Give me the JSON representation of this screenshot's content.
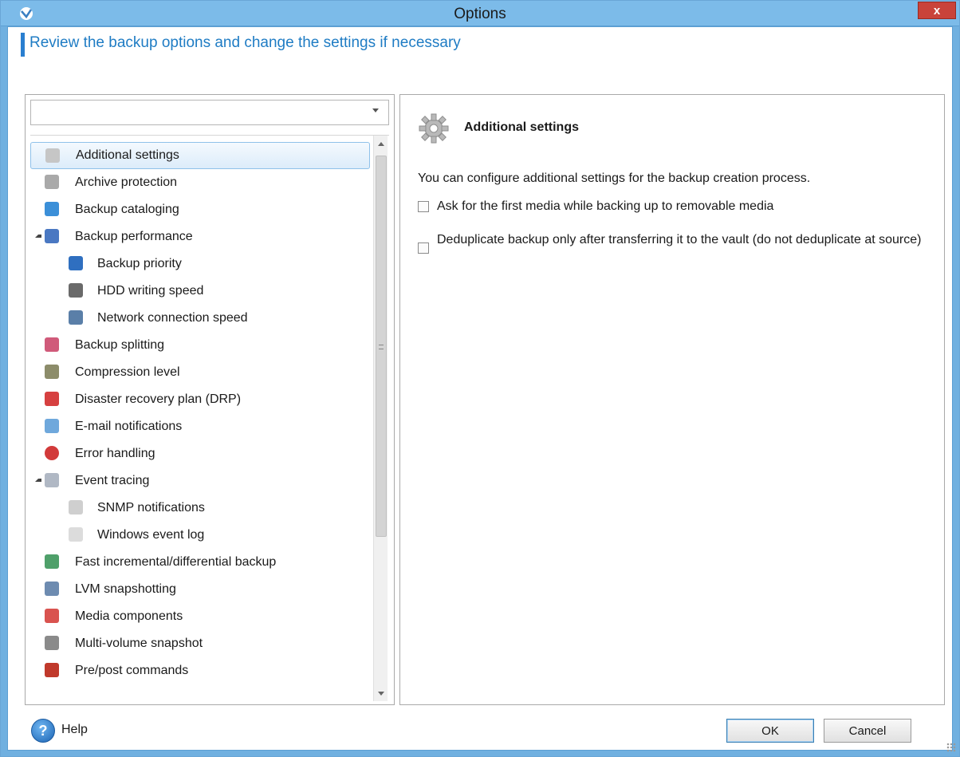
{
  "window": {
    "title": "Options",
    "close_label": "x"
  },
  "header": {
    "text": "Review the backup options and change the settings if necessary"
  },
  "filter": {
    "value": "",
    "placeholder": ""
  },
  "tree": {
    "items": [
      {
        "label": "Additional settings",
        "icon": "gear-icon",
        "level": 0,
        "selected": true
      },
      {
        "label": "Archive protection",
        "icon": "lock-icon",
        "level": 0
      },
      {
        "label": "Backup cataloging",
        "icon": "catalog-icon",
        "level": 0
      },
      {
        "label": "Backup performance",
        "icon": "performance-icon",
        "level": 0,
        "expanded": true
      },
      {
        "label": "Backup priority",
        "icon": "priority-icon",
        "level": 1
      },
      {
        "label": "HDD writing speed",
        "icon": "hdd-icon",
        "level": 1
      },
      {
        "label": "Network connection speed",
        "icon": "network-icon",
        "level": 1
      },
      {
        "label": "Backup splitting",
        "icon": "splitting-icon",
        "level": 0
      },
      {
        "label": "Compression level",
        "icon": "compression-icon",
        "level": 0
      },
      {
        "label": "Disaster recovery plan (DRP)",
        "icon": "drp-icon",
        "level": 0
      },
      {
        "label": "E-mail notifications",
        "icon": "email-icon",
        "level": 0
      },
      {
        "label": "Error handling",
        "icon": "error-icon",
        "level": 0
      },
      {
        "label": "Event tracing",
        "icon": "event-tracing-icon",
        "level": 0,
        "expanded": true
      },
      {
        "label": "SNMP notifications",
        "icon": "snmp-icon",
        "level": 1
      },
      {
        "label": "Windows event log",
        "icon": "event-log-icon",
        "level": 1
      },
      {
        "label": "Fast incremental/differential backup",
        "icon": "fast-backup-icon",
        "level": 0
      },
      {
        "label": "LVM snapshotting",
        "icon": "lvm-icon",
        "level": 0
      },
      {
        "label": "Media components",
        "icon": "media-icon",
        "level": 0
      },
      {
        "label": "Multi-volume snapshot",
        "icon": "multi-volume-icon",
        "level": 0
      },
      {
        "label": "Pre/post commands",
        "icon": "commands-icon",
        "level": 0
      }
    ]
  },
  "details": {
    "title": "Additional settings",
    "icon": "gear-icon",
    "description": "You can configure additional settings for the backup creation process.",
    "options": [
      {
        "label": "Ask for the first media while backing up to removable media",
        "checked": false
      },
      {
        "label": "Deduplicate backup only after transferring it to the vault (do not deduplicate at source)",
        "checked": false
      }
    ]
  },
  "footer": {
    "help_label": "Help",
    "ok_label": "OK",
    "cancel_label": "Cancel"
  },
  "colors": {
    "titlebar": "#7cbbe9",
    "accent": "#1f7cc4",
    "close": "#c9433a"
  }
}
